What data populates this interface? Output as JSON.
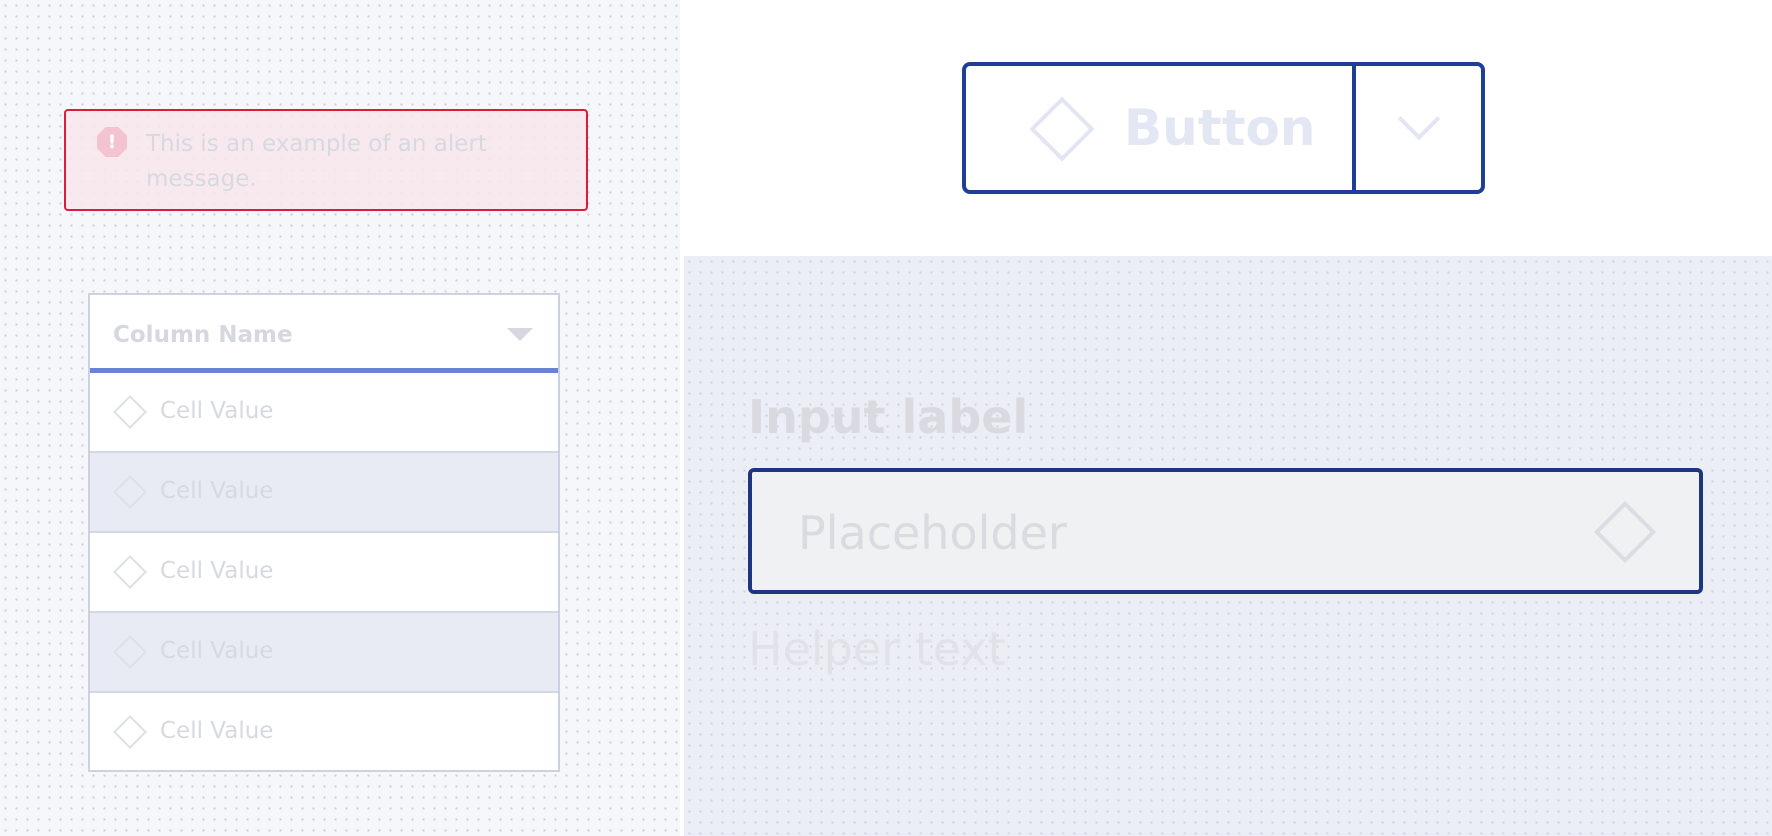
{
  "alert": {
    "icon": "error-octagon-icon",
    "message": "This is an example of an alert message.",
    "color": "#da1e3a"
  },
  "table": {
    "column_name": "Column Name",
    "sort_icon": "caret-down-icon",
    "rows": [
      {
        "icon": "diamond-icon",
        "value": "Cell Value"
      },
      {
        "icon": "diamond-icon",
        "value": "Cell Value"
      },
      {
        "icon": "diamond-icon",
        "value": "Cell Value"
      },
      {
        "icon": "diamond-icon",
        "value": "Cell Value"
      },
      {
        "icon": "diamond-icon",
        "value": "Cell Value"
      }
    ],
    "header_accent": "#6b83d4"
  },
  "split_button": {
    "label": "Button",
    "icon": "diamond-icon",
    "menu_icon": "chevron-down-icon",
    "border_color": "#1f3e96"
  },
  "input": {
    "label": "Input label",
    "placeholder": "Placeholder",
    "icon": "diamond-icon",
    "helper_text": "Helper text",
    "border_color": "#1c3680"
  }
}
